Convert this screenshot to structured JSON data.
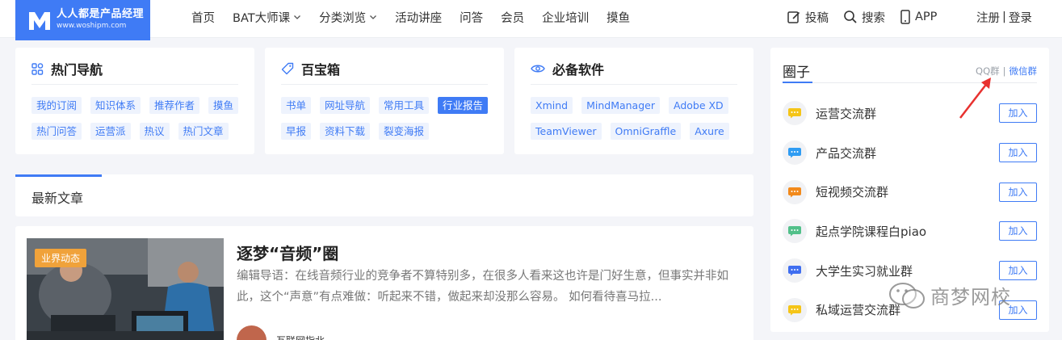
{
  "header": {
    "logo": {
      "title": "人人都是产品经理",
      "url": "www.woshipm.com"
    },
    "nav": [
      {
        "label": "首页",
        "has_menu": false
      },
      {
        "label": "BAT大师课",
        "has_menu": true
      },
      {
        "label": "分类浏览",
        "has_menu": true
      },
      {
        "label": "活动讲座",
        "has_menu": false
      },
      {
        "label": "问答",
        "has_menu": false
      },
      {
        "label": "会员",
        "has_menu": false
      },
      {
        "label": "企业培训",
        "has_menu": false
      },
      {
        "label": "摸鱼",
        "has_menu": false
      }
    ],
    "submit_label": "投稿",
    "search_label": "搜索",
    "app_label": "APP",
    "register_label": "注册",
    "auth_sep": "|",
    "login_label": "登录"
  },
  "hot_nav": {
    "title": "热门导航",
    "icon": "grid-icon",
    "tags": [
      "我的订阅",
      "知识体系",
      "推荐作者",
      "摸鱼",
      "热门问答",
      "运营派",
      "热议",
      "热门文章"
    ]
  },
  "toolbox": {
    "title": "百宝箱",
    "icon": "tag-icon",
    "tags": [
      "书单",
      "网址导航",
      "常用工具",
      "行业报告",
      "早报",
      "资料下载",
      "裂变海报"
    ],
    "active_tag": "行业报告"
  },
  "software": {
    "title": "必备软件",
    "icon": "eye-icon",
    "tags": [
      "Xmind",
      "MindManager",
      "Adobe XD",
      "TeamViewer",
      "OmniGraffle",
      "Axure"
    ]
  },
  "latest": {
    "title": "最新文章"
  },
  "article": {
    "badge": "业界动态",
    "title": "逐梦“音频”圈",
    "desc": "编辑导语：在线音频行业的竞争者不算特别多，在很多人看来这也许是门好生意，但事实并非如此，这个“声意”有点难做：听起来不错，做起来却没那么容易。 如何看待喜马拉...",
    "author": "互联网指北"
  },
  "circle": {
    "title": "圈子",
    "qq_label": "QQ群",
    "sep": "|",
    "wechat_label": "微信群",
    "join_label": "加入",
    "groups": [
      {
        "name": "运营交流群",
        "color": "#f5c518"
      },
      {
        "name": "产品交流群",
        "color": "#2f9cf3"
      },
      {
        "name": "短视频交流群",
        "color": "#f28a1c"
      },
      {
        "name": "起点学院课程白piao",
        "color": "#52c08a"
      },
      {
        "name": "大学生实习就业群",
        "color": "#3f6ef0"
      },
      {
        "name": "私域运营交流群",
        "color": "#f5c518"
      }
    ]
  },
  "watermark": {
    "text": "商梦网校"
  },
  "colors": {
    "accent": "#3f7bf5",
    "badge": "#f0a23a",
    "annotation_arrow": "#e8312f"
  }
}
